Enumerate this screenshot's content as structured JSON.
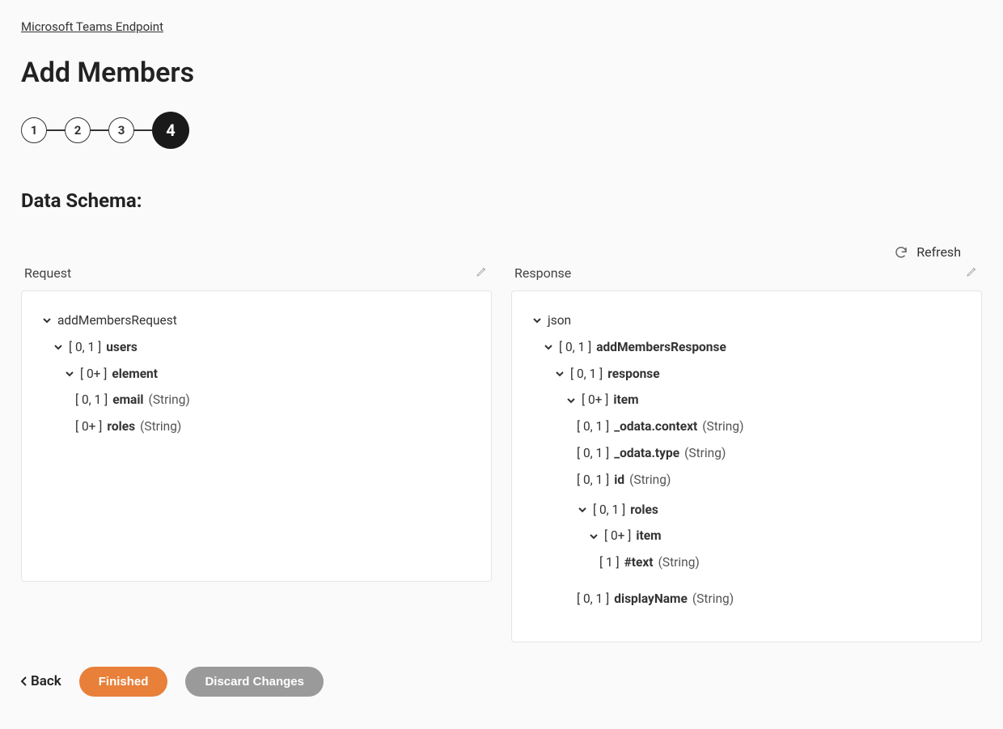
{
  "breadcrumb": "Microsoft Teams Endpoint",
  "page_title": "Add Members",
  "steps": [
    "1",
    "2",
    "3",
    "4"
  ],
  "active_step_index": 3,
  "section_title": "Data Schema:",
  "refresh_label": "Refresh",
  "columns": {
    "request": {
      "title": "Request"
    },
    "response": {
      "title": "Response"
    }
  },
  "request_tree": {
    "root": "addMembersRequest",
    "users": {
      "card": "[ 0, 1 ]",
      "name": "users"
    },
    "element": {
      "card": "[ 0+ ]",
      "name": "element"
    },
    "email": {
      "card": "[ 0, 1 ]",
      "name": "email",
      "type": "(String)"
    },
    "roles": {
      "card": "[ 0+ ]",
      "name": "roles",
      "type": "(String)"
    }
  },
  "response_tree": {
    "root": "json",
    "addMembersResponse": {
      "card": "[ 0, 1 ]",
      "name": "addMembersResponse"
    },
    "response": {
      "card": "[ 0, 1 ]",
      "name": "response"
    },
    "item": {
      "card": "[ 0+ ]",
      "name": "item"
    },
    "odata_context": {
      "card": "[ 0, 1 ]",
      "name": "_odata.context",
      "type": "(String)"
    },
    "odata_type": {
      "card": "[ 0, 1 ]",
      "name": "_odata.type",
      "type": "(String)"
    },
    "id": {
      "card": "[ 0, 1 ]",
      "name": "id",
      "type": "(String)"
    },
    "roles": {
      "card": "[ 0, 1 ]",
      "name": "roles"
    },
    "roles_item": {
      "card": "[ 0+ ]",
      "name": "item"
    },
    "text": {
      "card": "[ 1 ]",
      "name": "#text",
      "type": "(String)"
    },
    "displayName": {
      "card": "[ 0, 1 ]",
      "name": "displayName",
      "type": "(String)"
    }
  },
  "footer": {
    "back": "Back",
    "finished": "Finished",
    "discard": "Discard Changes"
  }
}
